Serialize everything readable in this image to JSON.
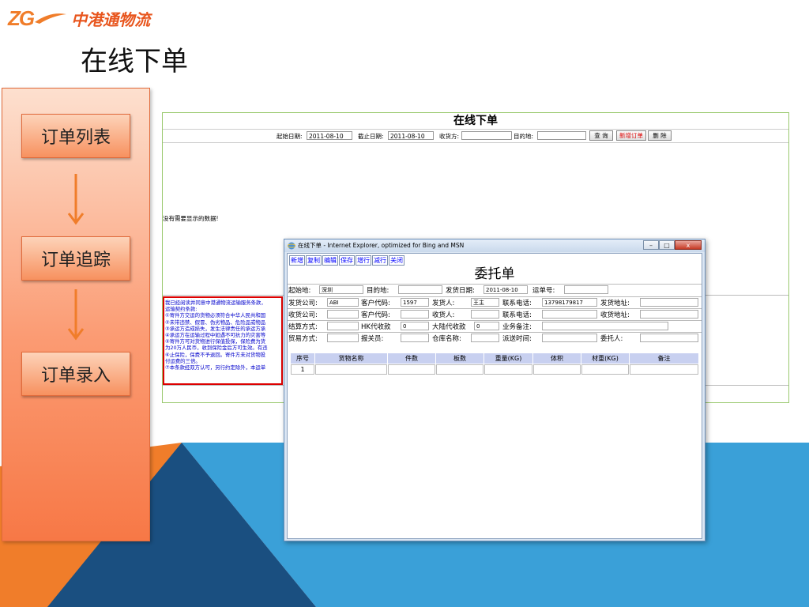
{
  "logo": {
    "zg": "ZG",
    "name": "中港通物流"
  },
  "page_title": "在线下单",
  "flow": {
    "steps": [
      "订单列表",
      "订单追踪",
      "订单录入"
    ]
  },
  "colors": {
    "orange": "#f07d2a",
    "blue": "#3aa0d8",
    "dark_blue": "#1a4f80",
    "flow_red": "#e06a3a"
  },
  "web": {
    "title": "在线下单",
    "filters": {
      "start_label": "起始日期:",
      "start_value": "2011-08-10",
      "end_label": "截止日期:",
      "end_value": "2011-08-10",
      "receiver_label": "收货方:",
      "destination_label": "目的地:"
    },
    "buttons": {
      "query": "查 询",
      "new_order": "新增订单",
      "delete": "删 除"
    },
    "empty_message": "没有需要显示的数据!",
    "terms_lines": [
      "我已经阅读并同意中港通物流运输服务条款，",
      "运输契约条款:",
      "①寄件方交运的货物必须符合中华人民共和国",
      "②未带违禁、假冒、伪劣物品、危险品或物品",
      "③承运方造成损失，发生法律责任的承运方承",
      "④承运方在运输过程中如遇不可抗力的灾害等",
      "⑤寄件方可对货物进行保值投保，保险费为货",
      "为20万人民币，收到保险金后方可生效。有违",
      "⑥止保险，保费不予退回。寄件方未对货物投",
      "付运费的三倍。",
      "⑦本条款经双方认可，另行约定除外，本运单"
    ]
  },
  "popup": {
    "window_title": "在线下单 - Internet Explorer, optimized for Bing and MSN",
    "window_buttons": {
      "minimize": "–",
      "maximize": "□",
      "close": "x"
    },
    "toolbar": [
      "新增",
      "复制",
      "编辑",
      "保存",
      "增行",
      "减行",
      "关闭"
    ],
    "heading": "委托单",
    "row1": {
      "origin_label": "起始地:",
      "origin_value": "深圳",
      "dest_label": "目的地:",
      "ship_date_label": "发货日期:",
      "ship_date_value": "2011-08-10",
      "waybill_label": "运单号:"
    },
    "row2": {
      "sender_co_label": "发货公司:",
      "sender_co_value": "ABI",
      "customer_code_label": "客户代码:",
      "customer_code_value": "1597",
      "sender_label": "发货人:",
      "sender_value": "王主",
      "phone_label": "联系电话:",
      "phone_value": "13798179817",
      "ship_addr_label": "发货地址:"
    },
    "row3": {
      "receiver_co_label": "收货公司:",
      "customer_code_label": "客户代码:",
      "receiver_label": "收货人:",
      "phone_label": "联系电话:",
      "recv_addr_label": "收货地址:"
    },
    "row4": {
      "settle_label": "结算方式:",
      "hk_cod_label": "HK代收款",
      "hk_cod_value": "0",
      "mainland_cod_label": "大陆代收款",
      "mainland_cod_value": "0",
      "remark_label": "业务备注:"
    },
    "row5": {
      "trade_label": "贸易方式:",
      "customs_label": "报关员:",
      "warehouse_label": "仓库名称:",
      "delivery_label": "派送时间:",
      "client_label": "委托人:"
    },
    "table": {
      "headers": [
        "序号",
        "货物名称",
        "件数",
        "板数",
        "重量(KG)",
        "体积",
        "材重(KG)",
        "备注"
      ],
      "row_index": "1"
    }
  }
}
